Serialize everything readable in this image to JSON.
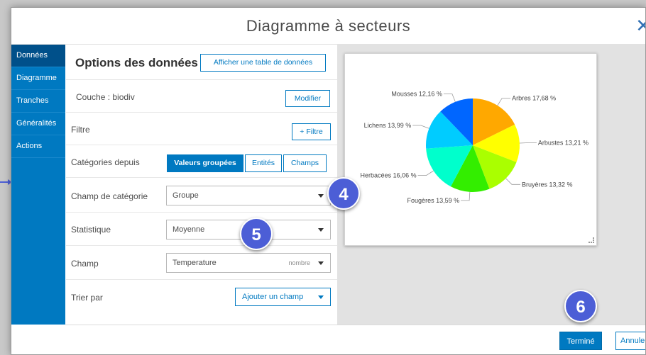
{
  "dialog": {
    "title": "Diagramme à secteurs",
    "close_icon": "close-icon"
  },
  "sidebar": {
    "items": [
      {
        "label": "Données",
        "active": true
      },
      {
        "label": "Diagramme",
        "active": false
      },
      {
        "label": "Tranches",
        "active": false
      },
      {
        "label": "Généralités",
        "active": false
      },
      {
        "label": "Actions",
        "active": false
      }
    ]
  },
  "options": {
    "title": "Options des données",
    "show_table_label": "Afficher une table de données",
    "layer_label": "Couche : biodiv",
    "modify_label": "Modifier",
    "filter_label": "Filtre",
    "add_filter_label": "+ Filtre",
    "categories_label": "Catégories depuis",
    "category_tabs": [
      {
        "label": "Valeurs groupées",
        "active": true
      },
      {
        "label": "Entités",
        "active": false
      },
      {
        "label": "Champs",
        "active": false
      }
    ],
    "category_field_label": "Champ de catégorie",
    "category_field_value": "Groupe",
    "statistic_label": "Statistique",
    "statistic_value": "Moyenne",
    "field_label": "Champ",
    "field_value": "Temperature",
    "field_type": "nombre",
    "sort_label": "Trier par",
    "add_field_label": "Ajouter un champ"
  },
  "footer": {
    "done_label": "Terminé",
    "cancel_label": "Annuler"
  },
  "badges": [
    "4",
    "5",
    "6"
  ],
  "chart_data": {
    "type": "pie",
    "title": "",
    "slices": [
      {
        "label": "Arbres 17,68 %",
        "value": 17.68,
        "color": "#ffa800"
      },
      {
        "label": "Arbustes 13,21 %",
        "value": 13.21,
        "color": "#ffff00"
      },
      {
        "label": "Bruyères 13,32 %",
        "value": 13.32,
        "color": "#aaff00"
      },
      {
        "label": "Fougères 13,59 %",
        "value": 13.59,
        "color": "#33ee00"
      },
      {
        "label": "Herbacées 16,06 %",
        "value": 16.06,
        "color": "#00ffcc"
      },
      {
        "label": "Lichens 13,99 %",
        "value": 13.99,
        "color": "#00ccff"
      },
      {
        "label": "Mousses 12,16 %",
        "value": 12.16,
        "color": "#0066ff"
      }
    ],
    "start_angle_deg": 0,
    "direction": "clockwise",
    "label_side": [
      "right",
      "right",
      "right",
      "left",
      "left",
      "left",
      "left"
    ]
  }
}
